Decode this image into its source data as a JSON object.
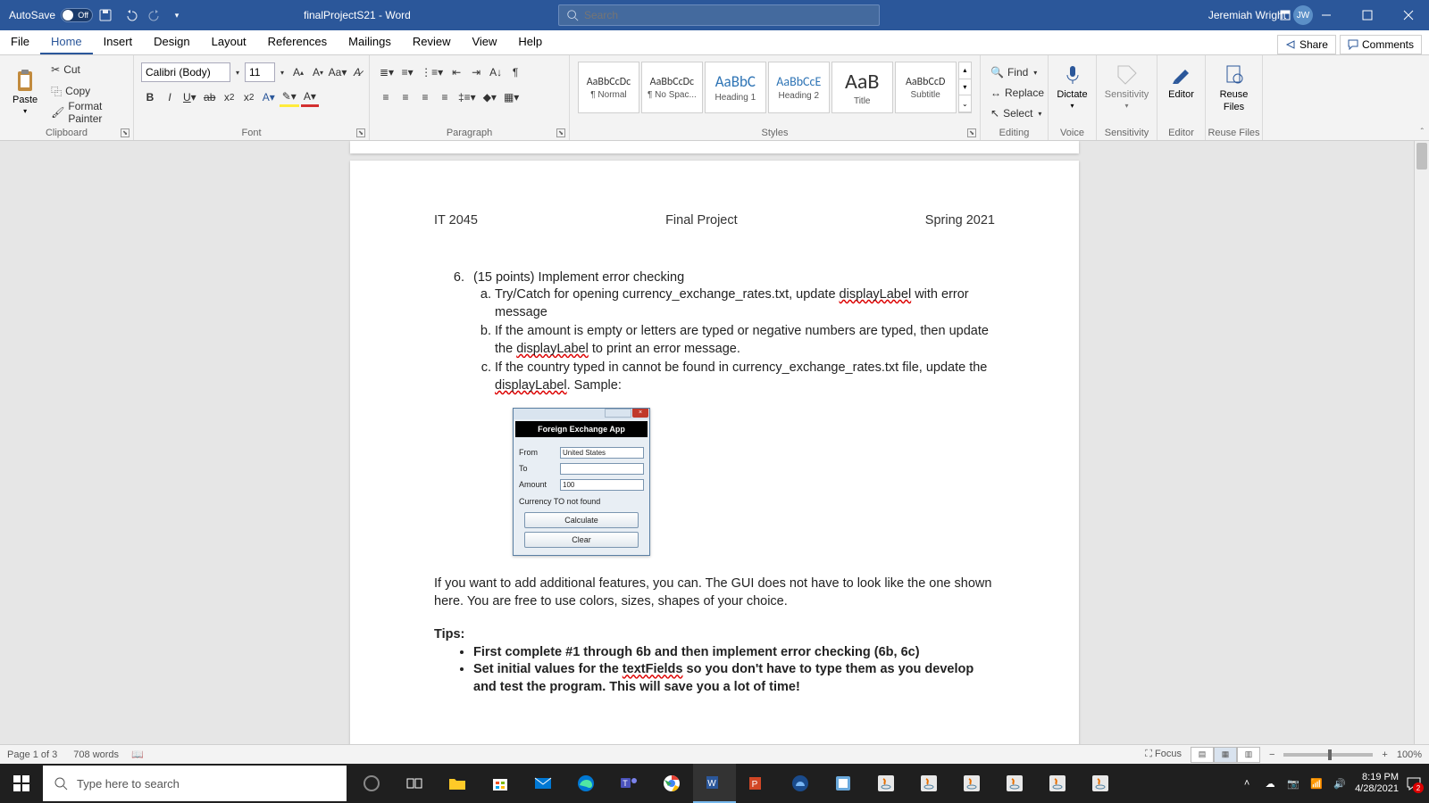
{
  "titlebar": {
    "autosave_label": "AutoSave",
    "autosave_state": "Off",
    "doc_title": "finalProjectS21  -  Word",
    "search_placeholder": "Search",
    "user_name": "Jeremiah Wright",
    "user_initials": "JW"
  },
  "ribbon_tabs": [
    "File",
    "Home",
    "Insert",
    "Design",
    "Layout",
    "References",
    "Mailings",
    "Review",
    "View",
    "Help"
  ],
  "ribbon_active_tab": "Home",
  "share": {
    "share_label": "Share",
    "comments_label": "Comments"
  },
  "clipboard": {
    "cut": "Cut",
    "copy": "Copy",
    "paste": "Paste",
    "fmt_painter": "Format Painter",
    "group_label": "Clipboard"
  },
  "font": {
    "name": "Calibri (Body)",
    "size": "11",
    "group_label": "Font"
  },
  "paragraph": {
    "group_label": "Paragraph"
  },
  "styles": {
    "group_label": "Styles",
    "items": [
      {
        "preview": "AaBbCcDc",
        "label": "¶ Normal",
        "cls": "sz12"
      },
      {
        "preview": "AaBbCcDc",
        "label": "¶ No Spac...",
        "cls": "sz12"
      },
      {
        "preview": "AaBbC",
        "label": "Heading 1",
        "cls": "sz18b"
      },
      {
        "preview": "AaBbCcE",
        "label": "Heading 2",
        "cls": "sz14b"
      },
      {
        "preview": "AaB",
        "label": "Title",
        "cls": "sz26"
      },
      {
        "preview": "AaBbCcD",
        "label": "Subtitle",
        "cls": "sz12i"
      }
    ]
  },
  "editing": {
    "find": "Find",
    "replace": "Replace",
    "select": "Select",
    "group_label": "Editing"
  },
  "voice": {
    "dictate": "Dictate",
    "group_label": "Voice"
  },
  "sensitivity": {
    "label": "Sensitivity",
    "group_label": "Sensitivity"
  },
  "editor": {
    "label": "Editor",
    "group_label": "Editor"
  },
  "reuse": {
    "label1": "Reuse",
    "label2": "Files",
    "group_label": "Reuse Files"
  },
  "doc": {
    "header_left": "IT 2045",
    "header_center": "Final Project",
    "header_right": "Spring 2021",
    "q6_num": "6.",
    "q6_text": "(15 points) Implement error checking",
    "a_text_1": "Try/Catch for opening currency_exchange_rates.txt, update ",
    "a_text_underline": "displayLabel",
    "a_text_2": " with error message",
    "b_text_1": "If the amount is empty or letters are typed or negative numbers are typed, then update the ",
    "b_text_underline": "displayLabel",
    "b_text_2": " to print an error message.",
    "c_text_1": "If the country typed in cannot be found in currency_exchange_rates.txt file, update the ",
    "c_text_underline": "displayLabel",
    "c_text_2": ". Sample:",
    "para_after": "If you want to add additional features, you can. The GUI does not have to look like the one shown here. You are free to use colors, sizes, shapes of your choice.",
    "tips_heading": "Tips:",
    "tip1": "First complete #1 through 6b and then implement error checking (6b, 6c)",
    "tip2_1": "Set initial values for the ",
    "tip2_underline": "textFields",
    "tip2_2": " so you don't have to type them as you develop and test the program. This will save you a lot of time!"
  },
  "mock": {
    "banner": "Foreign Exchange App",
    "from_label": "From",
    "from_value": "United States",
    "to_label": "To",
    "to_value": "",
    "amount_label": "Amount",
    "amount_value": "100",
    "status": "Currency TO not found",
    "calc_btn": "Calculate",
    "clear_btn": "Clear"
  },
  "statusbar": {
    "page": "Page 1 of 3",
    "words": "708 words",
    "focus": "Focus",
    "zoom": "100%"
  },
  "taskbar": {
    "search_placeholder": "Type here to search",
    "time": "8:19 PM",
    "date": "4/28/2021",
    "notif_count": "2"
  }
}
